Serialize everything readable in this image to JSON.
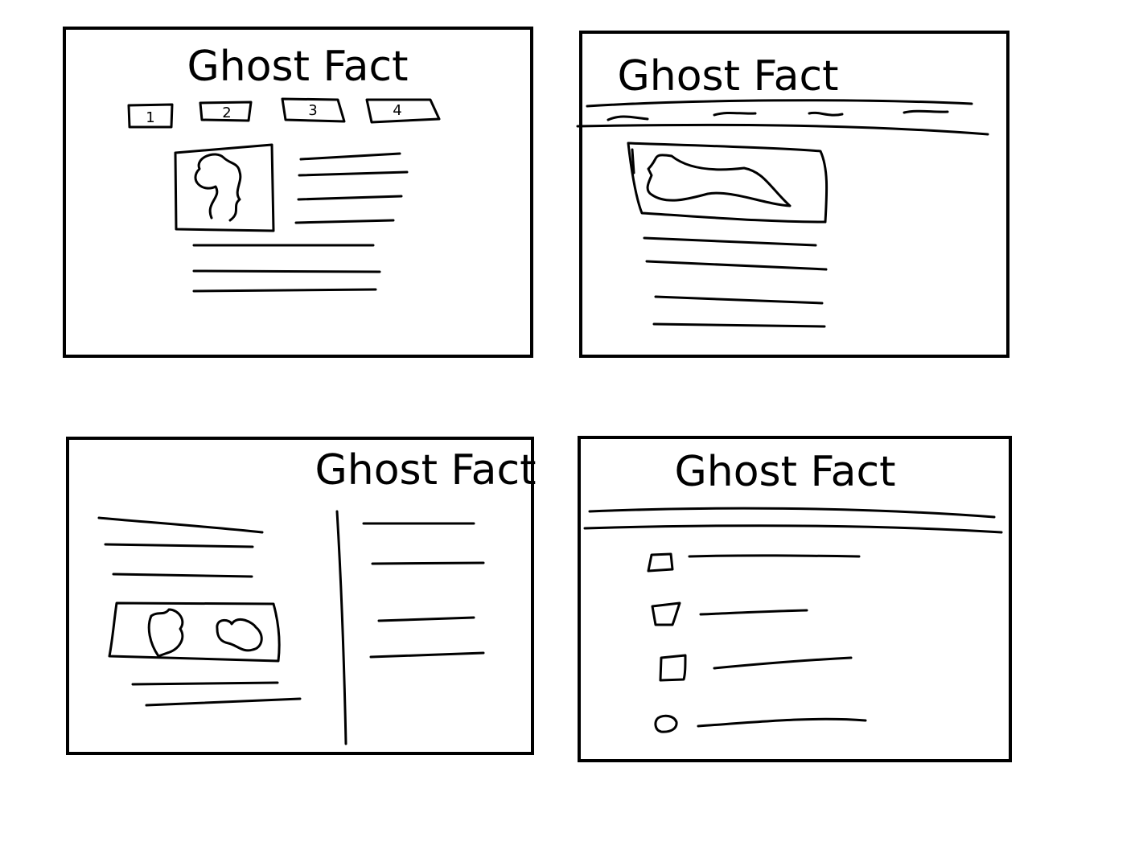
{
  "wireframes": [
    {
      "title": "Ghost Fact",
      "layout": "tabs",
      "tabs": [
        "1",
        "2",
        "3",
        "4"
      ]
    },
    {
      "title": "Ghost Fact",
      "layout": "nav-bar"
    },
    {
      "title": "Ghost Fact",
      "layout": "two-column"
    },
    {
      "title": "Ghost Fact",
      "layout": "list"
    }
  ]
}
